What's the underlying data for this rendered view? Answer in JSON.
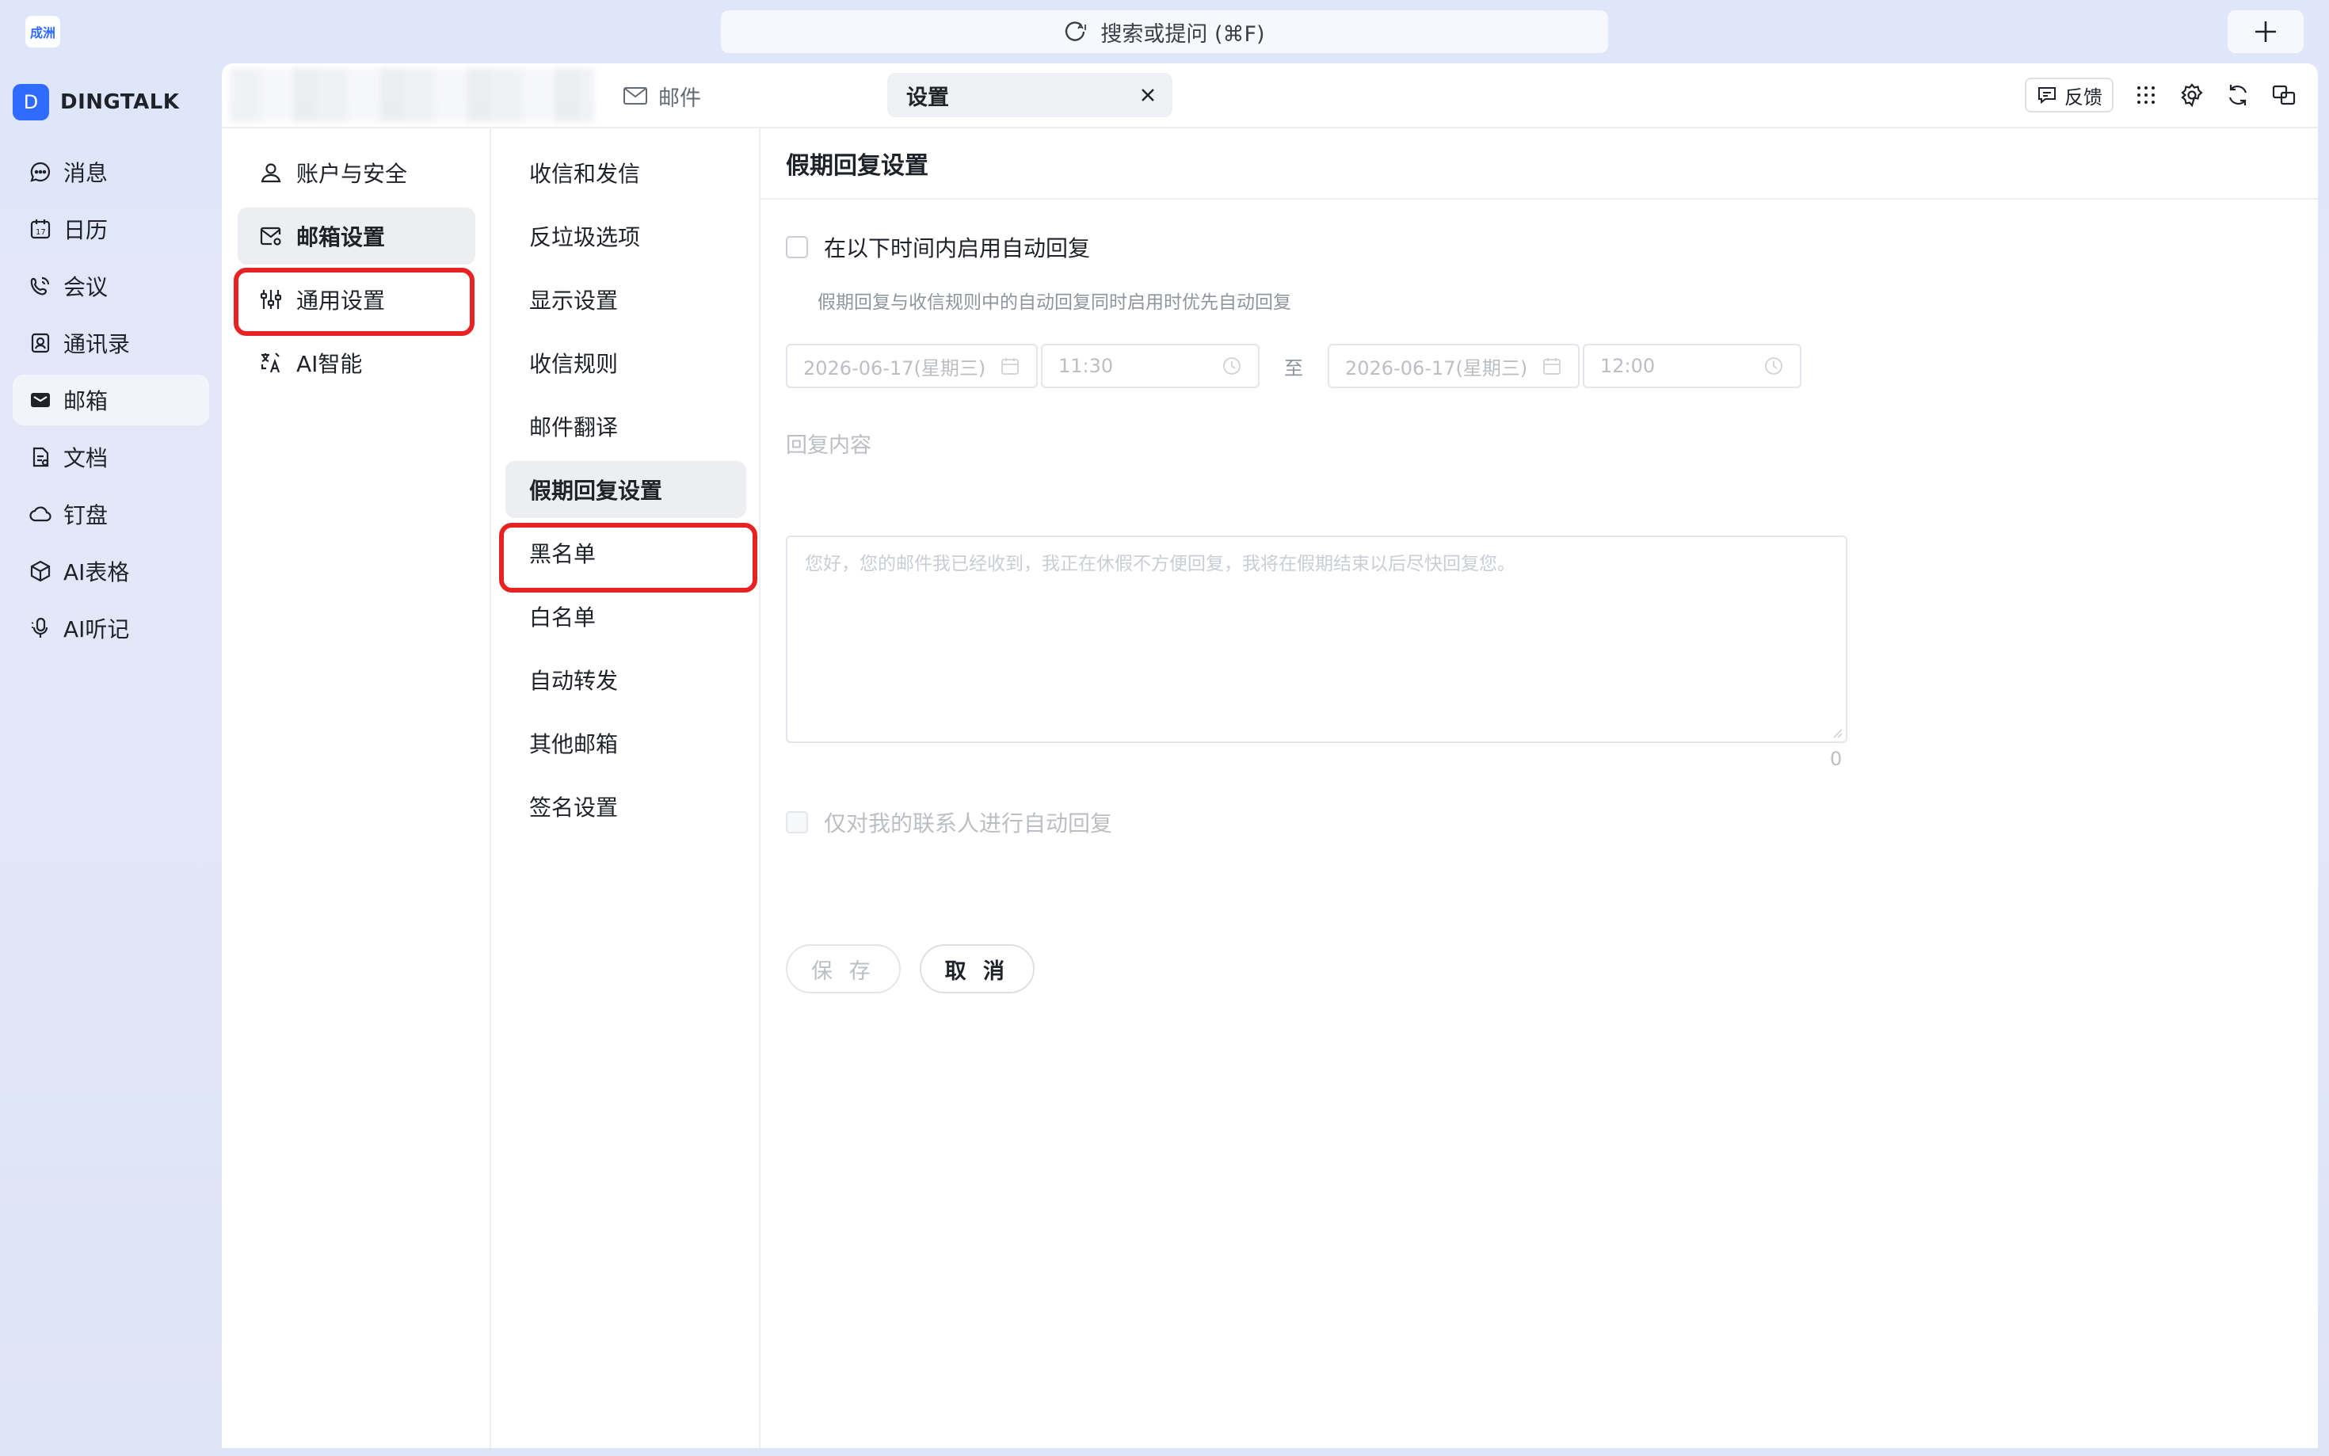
{
  "org": {
    "logo_text": "成洲"
  },
  "search": {
    "label": "搜索或提问 (⌘F)"
  },
  "brand": {
    "initial": "D",
    "name": "DINGTALK"
  },
  "nav": {
    "items": [
      {
        "label": "消息",
        "icon": "message-icon"
      },
      {
        "label": "日历",
        "icon": "calendar-icon"
      },
      {
        "label": "会议",
        "icon": "meeting-icon"
      },
      {
        "label": "通讯录",
        "icon": "contacts-icon"
      },
      {
        "label": "邮箱",
        "icon": "mail-icon",
        "active": true
      },
      {
        "label": "文档",
        "icon": "document-icon"
      },
      {
        "label": "钉盘",
        "icon": "cloud-disk-icon"
      },
      {
        "label": "AI表格",
        "icon": "ai-table-icon"
      },
      {
        "label": "AI听记",
        "icon": "ai-notes-icon"
      }
    ]
  },
  "tabs": {
    "mail": "邮件",
    "settings": "设置"
  },
  "header_actions": {
    "feedback": "反馈"
  },
  "settings_categories": [
    {
      "label": "账户与安全",
      "icon": "user-icon"
    },
    {
      "label": "邮箱设置",
      "icon": "mail-settings-icon",
      "active": true
    },
    {
      "label": "通用设置",
      "icon": "sliders-icon"
    },
    {
      "label": "AI智能",
      "icon": "ai-translate-icon"
    }
  ],
  "mail_settings": [
    {
      "label": "收信和发信"
    },
    {
      "label": "反垃圾选项"
    },
    {
      "label": "显示设置"
    },
    {
      "label": "收信规则"
    },
    {
      "label": "邮件翻译"
    },
    {
      "label": "假期回复设置",
      "active": true
    },
    {
      "label": "黑名单"
    },
    {
      "label": "白名单"
    },
    {
      "label": "自动转发"
    },
    {
      "label": "其他邮箱"
    },
    {
      "label": "签名设置"
    }
  ],
  "vacation": {
    "title": "假期回复设置",
    "enable_label": "在以下时间内启用自动回复",
    "hint": "假期回复与收信规则中的自动回复同时启用时优先自动回复",
    "start_date": "2026-06-17(星期三)",
    "start_time": "11:30",
    "to_label": "至",
    "end_date": "2026-06-17(星期三)",
    "end_time": "12:00",
    "reply_label": "回复内容",
    "reply_placeholder": "您好，您的邮件我已经收到，我正在休假不方便回复，我将在假期结束以后尽快回复您。",
    "reply_count": "0",
    "contacts_only_label": "仅对我的联系人进行自动回复",
    "save_label": "保 存",
    "cancel_label": "取 消"
  }
}
